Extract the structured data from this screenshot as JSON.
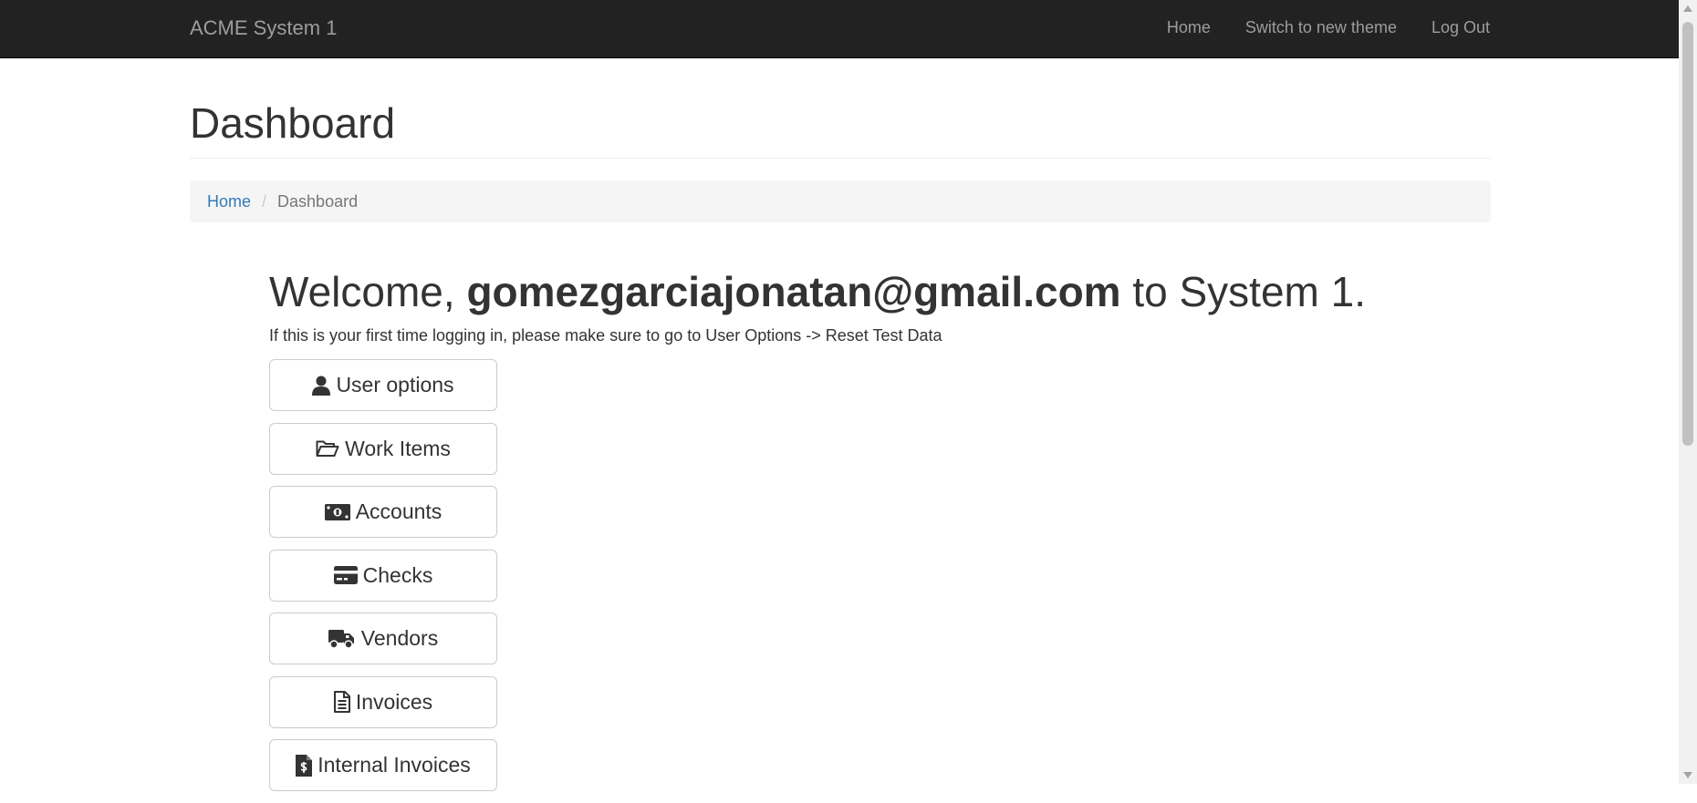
{
  "navbar": {
    "brand": "ACME System 1",
    "links": [
      {
        "label": "Home"
      },
      {
        "label": "Switch to new theme"
      },
      {
        "label": "Log Out"
      }
    ]
  },
  "page": {
    "title": "Dashboard"
  },
  "breadcrumb": {
    "home": "Home",
    "separator": "/",
    "current": "Dashboard"
  },
  "welcome": {
    "prefix": "Welcome, ",
    "email": "gomezgarciajonatan@gmail.com",
    "suffix": " to System 1.",
    "hint": "If this is your first time logging in, please make sure to go to User Options -> Reset Test Data"
  },
  "buttons": [
    {
      "label": "User options",
      "icon": "user-icon"
    },
    {
      "label": "Work Items",
      "icon": "folder-open-icon"
    },
    {
      "label": "Accounts",
      "icon": "money-bill-icon"
    },
    {
      "label": "Checks",
      "icon": "credit-card-icon"
    },
    {
      "label": "Vendors",
      "icon": "truck-icon"
    },
    {
      "label": "Invoices",
      "icon": "file-text-icon"
    },
    {
      "label": "Internal Invoices",
      "icon": "file-invoice-dollar-icon"
    }
  ],
  "colors": {
    "navbar_bg": "#222222",
    "nav_text": "#9d9d9d",
    "link": "#337ab7",
    "text": "#333333",
    "breadcrumb_bg": "#f5f5f5"
  }
}
